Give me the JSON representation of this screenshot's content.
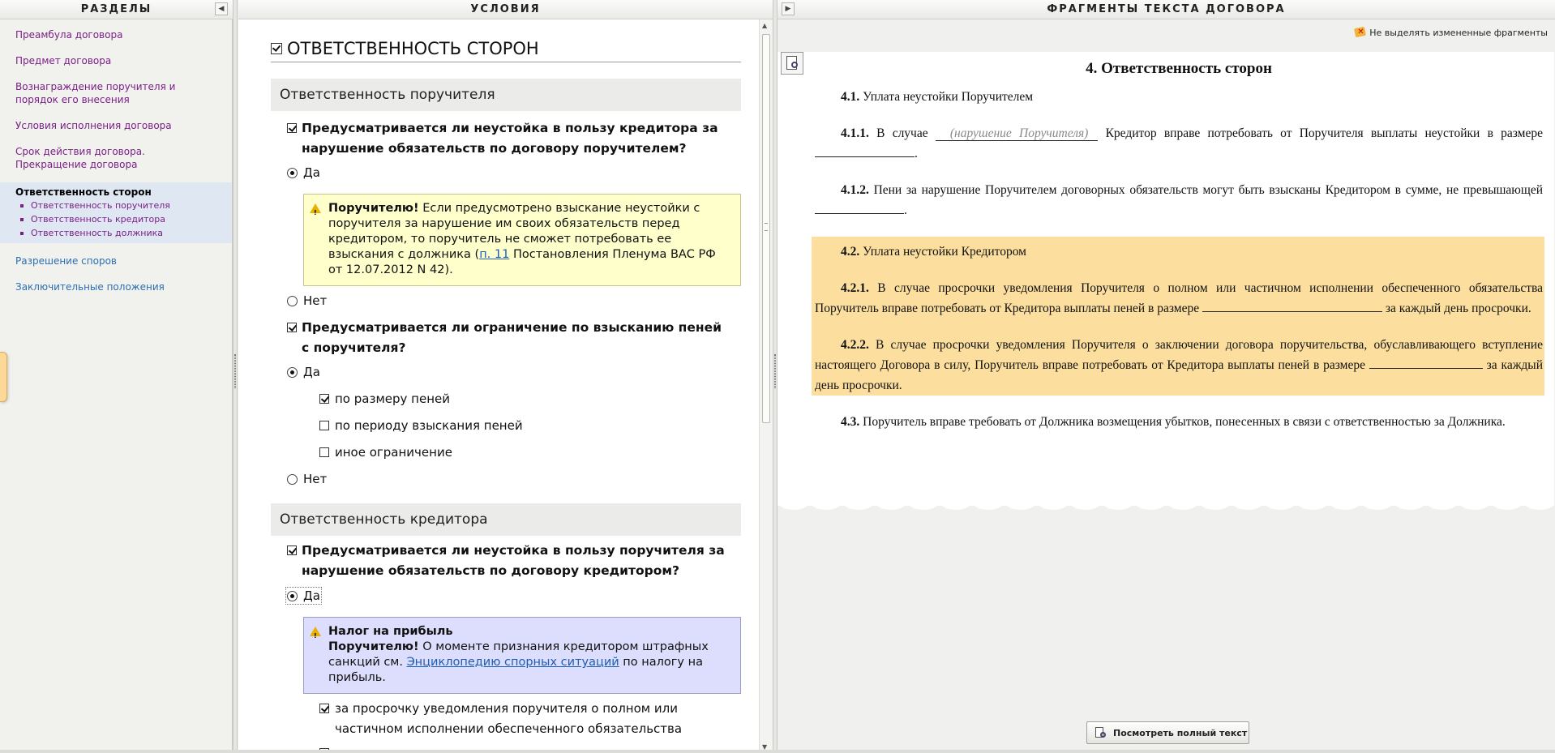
{
  "headers": {
    "sections": "РАЗДЕЛЫ",
    "conditions": "УСЛОВИЯ",
    "fragments": "ФРАГМЕНТЫ ТЕКСТА ДОГОВОРА"
  },
  "sidebar": {
    "items": [
      {
        "label": "Преамбула договора"
      },
      {
        "label": "Предмет договора"
      },
      {
        "label": "Вознаграждение поручителя и порядок его внесения"
      },
      {
        "label": "Условия исполнения договора"
      },
      {
        "label": "Срок действия договора. Прекращение договора"
      }
    ],
    "active": {
      "label": "Ответственность сторон",
      "sub": [
        "Ответственность поручителя",
        "Ответственность кредитора",
        "Ответственность должника"
      ]
    },
    "after": [
      {
        "label": "Разрешение споров"
      },
      {
        "label": "Заключительные положения"
      }
    ]
  },
  "conditions": {
    "title": "ОТВЕТСТВЕННОСТЬ СТОРОН",
    "group1": "Ответственность поручителя",
    "q1": "Предусматривается ли неустойка в пользу кредитора за нарушение обязательств по договору поручителем?",
    "yes": "Да",
    "no": "Нет",
    "note1": {
      "bold": "Поручителю!",
      "text1": " Если предусмотрено взыскание неустойки с поручителя за нарушение им своих обязательств перед кредитором, то поручитель не сможет потребовать ее взыскания с должника (",
      "link": "п. 11",
      "text2": " Постановления Пленума ВАС РФ от 12.07.2012 N 42)."
    },
    "q2": "Предусматривается ли ограничение по взысканию пеней с поручителя?",
    "q2_opts": [
      "по размеру пеней",
      "по периоду взыскания пеней",
      "иное ограничение"
    ],
    "group2": "Ответственность кредитора",
    "q3": "Предусматривается ли неустойка в пользу поручителя за нарушение обязательств по договору кредитором?",
    "note2": {
      "title": "Налог на прибыль",
      "bold": "Поручителю!",
      "text1": " О моменте признания кредитором штрафных санкций см. ",
      "link": "Энциклопедию спорных ситуаций",
      "text2": " по налогу на прибыль."
    },
    "q3_opt1": "за просрочку уведомления поручителя о полном или частичном исполнении обеспеченного обязательства"
  },
  "fragments": {
    "highlight_toggle": "Не выделять измененные фрагменты",
    "heading": "4. Ответственность сторон",
    "p41_num": "4.1.",
    "p41": " Уплата неустойки Поручителем",
    "p411_num": "4.1.1.",
    "p411_a": " В случае ",
    "p411_placeholder": "(нарушение Поручителя)",
    "p411_b": " Кредитор вправе потребовать от Поручителя выплаты неустойки в размере ",
    "p412_num": "4.1.2.",
    "p412": " Пени за нарушение Поручителем договорных обязательств могут быть взысканы Кредитором в сумме, не превышающей ",
    "p42_num": "4.2.",
    "p42": " Уплата неустойки Кредитором",
    "p421_num": "4.2.1.",
    "p421_a": " В случае просрочки уведомления Поручителя о полном или частичном исполнении обеспеченного обязательства Поручитель вправе потребовать от Кредитора выплаты пеней в размере ",
    "p421_b": " за каждый день просрочки.",
    "p422_num": "4.2.2.",
    "p422_a": " В случае просрочки уведомления Поручителя о заключении договора поручительства, обуславливающего вступление настоящего Договора в силу, Поручитель вправе потребовать от Кредитора выплаты пеней в размере ",
    "p422_b": " за каждый день просрочки.",
    "p43_num": "4.3.",
    "p43": " Поручитель вправе требовать от Должника возмещения убытков, понесенных в связи с ответственностью за Должника.",
    "view_full": "Посмотреть полный текст"
  },
  "colors": {
    "nav_link": "#7a1f86",
    "nav_blue": "#2d6fb0",
    "highlight": "#fcdf9e",
    "note_yellow": "#ffffcc",
    "note_blue": "#ddddfd"
  }
}
